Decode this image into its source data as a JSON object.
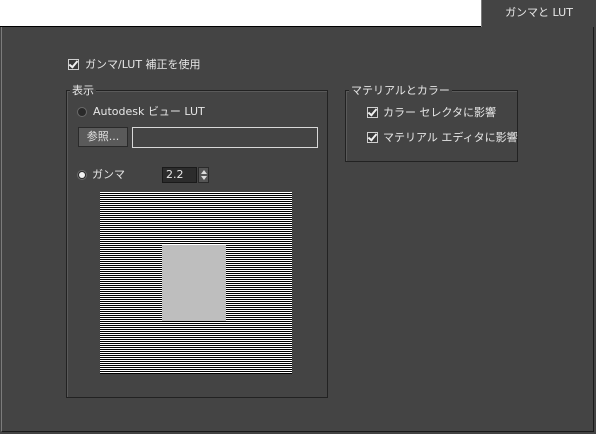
{
  "tab": {
    "label": "ガンマと LUT"
  },
  "enable": {
    "label": "ガンマ/LUT 補正を使用",
    "checked": true
  },
  "display": {
    "legend": "表示",
    "autodesk_lut": {
      "label": "Autodesk ビュー LUT",
      "selected": false
    },
    "browse_label": "参照...",
    "lut_path_value": "",
    "gamma": {
      "label": "ガンマ",
      "selected": true,
      "value": "2.2"
    }
  },
  "materials_colors": {
    "legend": "マテリアルとカラー",
    "color_selector": {
      "label": "カラー セレクタに影響",
      "checked": true
    },
    "material_editor": {
      "label": "マテリアル エディタに影響",
      "checked": true
    }
  }
}
